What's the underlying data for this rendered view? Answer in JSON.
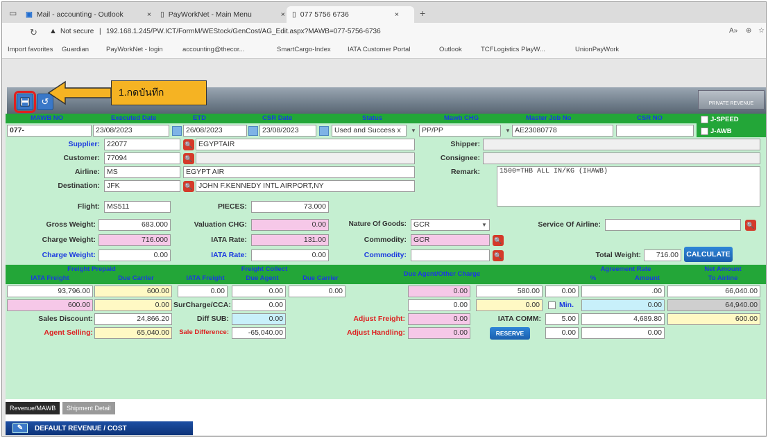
{
  "browser": {
    "tabs": [
      {
        "label": "Mail - accounting - Outlook"
      },
      {
        "label": "PayWorkNet - Main Menu"
      },
      {
        "label": "077 5756 6736"
      }
    ],
    "not_secure": "Not secure",
    "url": "192.168.1.245/PW.ICT/FormM/WEStock/GenCost/AG_Edit.aspx?MAWB=077-5756-6736",
    "bookmarks": [
      "Import favorites",
      "Guardian",
      "PayWorkNet - login",
      "accounting@thecor...",
      "SmartCargo-Index",
      "IATA Customer Portal",
      "Outlook",
      "TCFLogistics PlayW...",
      "UnionPayWork"
    ]
  },
  "callout": {
    "text": "1.กดบันทึก"
  },
  "toolbar": {
    "revenue_button": "PRIVATE REVENUE"
  },
  "header": {
    "mawb_no": "MAWB NO",
    "executed_date": "Executed Date",
    "etd": "ETD",
    "csr_date": "CSR Date",
    "status": "Status",
    "mawb_chg": "Mawb CHG",
    "master_job_no": "Master Job No",
    "csr_no": "CSR NO",
    "speed": "J-SPEED",
    "jawb": "J-AWB"
  },
  "values": {
    "mawb_no": "077-",
    "executed_date": "23/08/2023",
    "etd": "26/08/2023",
    "csr_date": "23/08/2023",
    "status": "Used and Success x",
    "mawb_chg": "PP/PP",
    "master_job_no": "AE23080778",
    "csr_no": ""
  },
  "form": {
    "supplier_label": "Supplier:",
    "supplier_code": "22077",
    "supplier_name": "EGYPTAIR",
    "customer_label": "Customer:",
    "customer_code": "77094",
    "customer_name": "",
    "airline_label": "Airline:",
    "airline_code": "MS",
    "airline_name": "EGYPT AIR",
    "destination_label": "Destination:",
    "destination_code": "JFK",
    "destination_name": "JOHN F.KENNEDY INTL AIRPORT,NY",
    "flight_label": "Flight:",
    "flight": "MS511",
    "pieces_label": "PIECES:",
    "pieces": "73.000",
    "shipper_label": "Shipper:",
    "consignee_label": "Consignee:",
    "remark_label": "Remark:",
    "remark": "1500=THB   ALL IN/KG (IHAWB)",
    "gross_weight_label": "Gross Weight:",
    "gross_weight": "683.000",
    "valuation_chg_label": "Valuation CHG:",
    "valuation_chg": "0.00",
    "nature_goods_label": "Nature Of Goods:",
    "nature_goods": "GCR",
    "service_airline_label": "Service Of Airline:",
    "service_airline": "",
    "charge_weight_label": "Charge Weight:",
    "charge_weight": "716.000",
    "iata_rate_label": "IATA Rate:",
    "iata_rate": "131.00",
    "commodity_label": "Commodity:",
    "commodity": "GCR",
    "charge_weight2_label": "Charge Weight:",
    "charge_weight2": "0.00",
    "iata_rate2_label": "IATA Rate:",
    "iata_rate2": "0.00",
    "commodity2_label": "Commodity:",
    "commodity2": "",
    "total_weight_label": "Total Weight:",
    "total_weight": "716.00",
    "calculate": "CALCULATE"
  },
  "table": {
    "freight_prepaid": "Freight Prepaid",
    "freight_collect": "Freight Collect",
    "due_agent_other": "Due Agent/Other Charge",
    "agreement_rate": "Agreement Rate",
    "net_amount": "Net Amount",
    "iata_freight": "IATA Freight",
    "due_carrier": "Due Carrier",
    "iata_freight2": "IATA Freight",
    "due_agent": "Due Agent",
    "due_carrier2": "Due Carrier",
    "percent": "%",
    "amount": "Amount",
    "to_airline": "To Airline",
    "r1": {
      "iata_freight": "93,796.00",
      "due_carrier": "600.00",
      "iata_freight_c": "0.00",
      "due_agent": "0.00",
      "due_carrier_c": "0.00",
      "other1": "0.00",
      "other2": "580.00",
      "percent": "0.00",
      "amount": ".00",
      "net": "66,040.00"
    },
    "r2": {
      "a": "600.00",
      "b": "0.00",
      "surcharge_label": "SurCharge/CCA:",
      "surcharge": "0.00",
      "c": "0.00",
      "d": "0.00",
      "min": "Min.",
      "amount": "0.00",
      "net": "64,940.00"
    },
    "r3": {
      "sales_discount_label": "Sales Discount:",
      "sales_discount": "24,866.20",
      "diff_sub_label": "Diff SUB:",
      "diff_sub": "0.00",
      "adjust_freight_label": "Adjust Freight:",
      "adjust_freight": "0.00",
      "iata_comm_label": "IATA COMM:",
      "iata_comm_pct": "5.00",
      "iata_comm_amt": "4,689.80",
      "net": "600.00"
    },
    "r4": {
      "agent_selling_label": "Agent Selling:",
      "agent_selling": "65,040.00",
      "sale_diff_label": "Sale Difference:",
      "sale_diff": "-65,040.00",
      "adjust_handling_label": "Adjust Handling:",
      "adjust_handling": "0.00",
      "reserve": "RESERVE",
      "v1": "0.00",
      "v2": "0.00"
    }
  },
  "bottom": {
    "tab1": "Revenue/MAWB",
    "tab2": "Shipment Detail",
    "default_button": "DEFAULT REVENUE / COST"
  }
}
